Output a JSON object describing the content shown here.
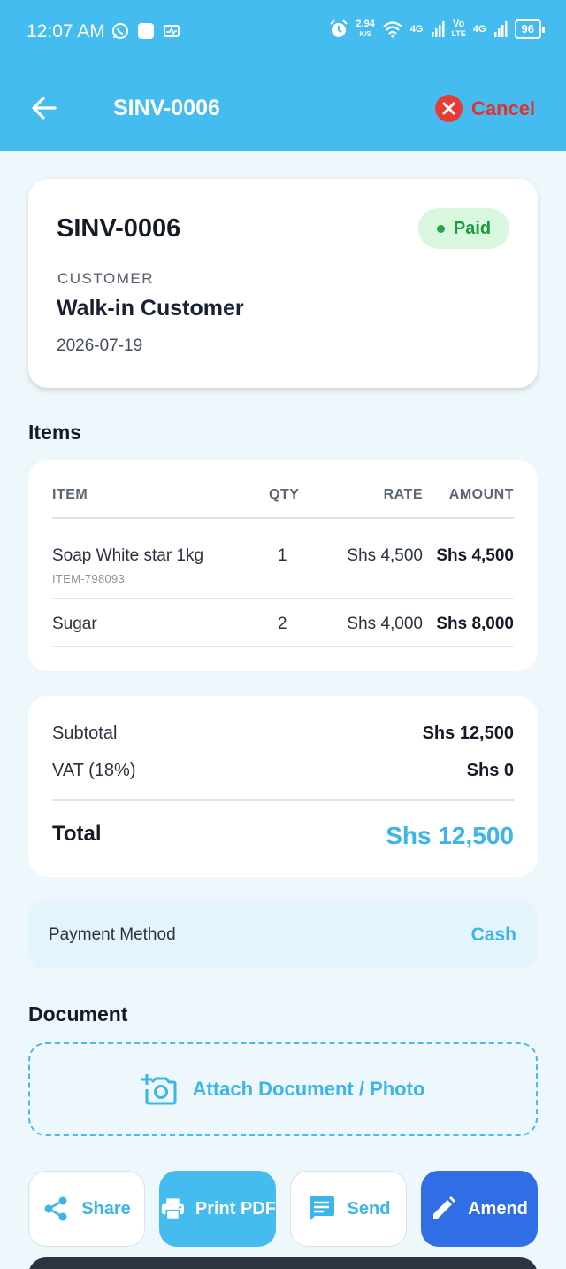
{
  "status_bar": {
    "time": "12:07 AM",
    "speed_value": "2.94",
    "speed_unit": "K/S",
    "net1": "4G",
    "volte_top": "Vo",
    "volte_bottom": "LTE",
    "net2": "4G",
    "battery": "96"
  },
  "app_bar": {
    "title": "SINV-0006",
    "cancel_label": "Cancel"
  },
  "invoice": {
    "number": "SINV-0006",
    "status": "Paid",
    "customer_label": "CUSTOMER",
    "customer_name": "Walk-in Customer",
    "date": "2026-07-19"
  },
  "items_section": {
    "title": "Items",
    "headers": {
      "item": "ITEM",
      "qty": "QTY",
      "rate": "RATE",
      "amount": "AMOUNT"
    },
    "rows": [
      {
        "name": "Soap White star 1kg",
        "code": "ITEM-798093",
        "qty": "1",
        "rate": "Shs 4,500",
        "amount": "Shs 4,500"
      },
      {
        "name": "Sugar",
        "code": "",
        "qty": "2",
        "rate": "Shs 4,000",
        "amount": "Shs 8,000"
      }
    ]
  },
  "totals": {
    "subtotal_label": "Subtotal",
    "subtotal_value": "Shs 12,500",
    "vat_label": "VAT (18%)",
    "vat_value": "Shs 0",
    "total_label": "Total",
    "total_value": "Shs 12,500"
  },
  "payment": {
    "label": "Payment Method",
    "value": "Cash"
  },
  "document": {
    "title": "Document",
    "attach_label": "Attach Document / Photo"
  },
  "actions": {
    "share": "Share",
    "print_pdf": "Print PDF",
    "send": "Send",
    "amend": "Amend"
  },
  "colors": {
    "primary": "#45bcef",
    "danger": "#e63b37",
    "paid_bg": "#d9f6df",
    "paid_text": "#1a9c3e",
    "amend": "#2f6ee5"
  }
}
